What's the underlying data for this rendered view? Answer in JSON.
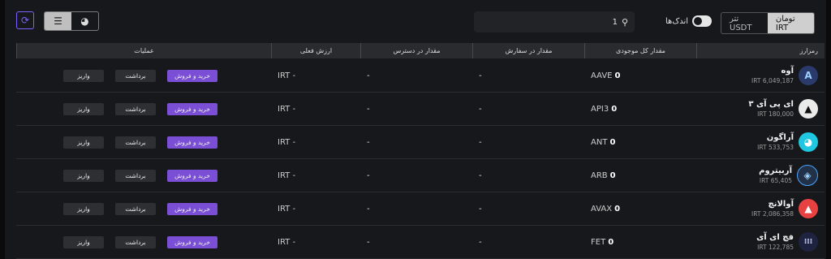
{
  "toolbar": {
    "search_value": "1",
    "small_label": "اندک‌ها",
    "currency_irt": "تومان IRT",
    "currency_usdt": "تتر USDT"
  },
  "headers": {
    "symbol": "رمزارز",
    "total": "مقدار کل موجودی",
    "in_order": "مقدار در سفارش",
    "available": "مقدار در دسترس",
    "value": "ارزش فعلی",
    "ops": "عملیات"
  },
  "buttons": {
    "trade": "خرید و فروش",
    "withdraw": "برداشت",
    "deposit": "واریز"
  },
  "dash": "-",
  "value_text": "IRT -",
  "rows": [
    {
      "name": "آوه",
      "price": "IRT 6,049,187",
      "sym": "AAVE",
      "bal": "0"
    },
    {
      "name": "ای پی آی ۳",
      "price": "IRT 180,000",
      "sym": "API3",
      "bal": "0"
    },
    {
      "name": "آراگون",
      "price": "IRT 533,753",
      "sym": "ANT",
      "bal": "0"
    },
    {
      "name": "آربیتروم",
      "price": "IRT 65,405",
      "sym": "ARB",
      "bal": "0"
    },
    {
      "name": "آوالانچ",
      "price": "IRT 2,086,358",
      "sym": "AVAX",
      "bal": "0"
    },
    {
      "name": "فچ ای آی",
      "price": "IRT 122,785",
      "sym": "FET",
      "bal": "0"
    }
  ],
  "icons": [
    "aave-icon",
    "api3-icon",
    "aragon-icon",
    "arbitrum-icon",
    "avalanche-icon",
    "fetch-icon"
  ],
  "colors": {
    "accent": "#7a4fd6"
  }
}
